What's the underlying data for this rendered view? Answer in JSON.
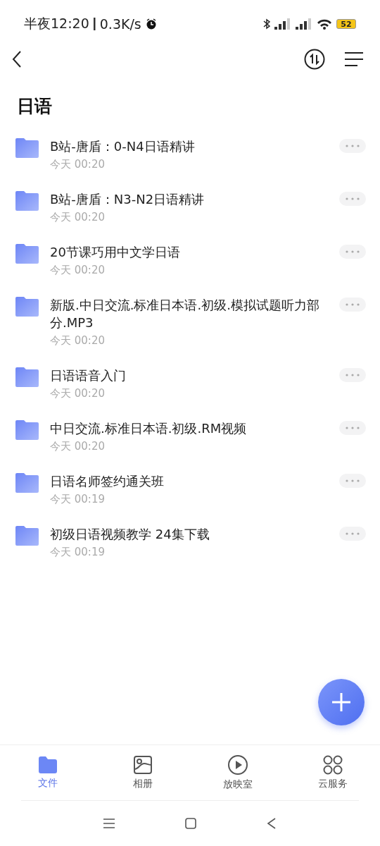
{
  "status_bar": {
    "time": "半夜12:20",
    "speed": "0.3K/s",
    "battery": "52"
  },
  "title": "日语",
  "folders": [
    {
      "name": "B站-唐盾：0-N4日语精讲",
      "date": "今天 00:20"
    },
    {
      "name": "B站-唐盾：N3-N2日语精讲",
      "date": "今天 00:20"
    },
    {
      "name": "20节课巧用中文学日语",
      "date": "今天 00:20"
    },
    {
      "name": "新版.中日交流.标准日本语.初级.模拟试题听力部分.MP3",
      "date": "今天 00:20"
    },
    {
      "name": "日语语音入门",
      "date": "今天 00:20"
    },
    {
      "name": "中日交流.标准日本语.初级.RM视频",
      "date": "今天 00:20"
    },
    {
      "name": "日语名师签约通关班",
      "date": "今天 00:19"
    },
    {
      "name": "初级日语视频教学 24集下载",
      "date": "今天 00:19"
    }
  ],
  "tabs": [
    {
      "kind": "files",
      "label": "文件",
      "selected": true
    },
    {
      "kind": "album",
      "label": "相册",
      "selected": false
    },
    {
      "kind": "player",
      "label": "放映室",
      "selected": false
    },
    {
      "kind": "cloud",
      "label": "云服务",
      "selected": false
    }
  ]
}
